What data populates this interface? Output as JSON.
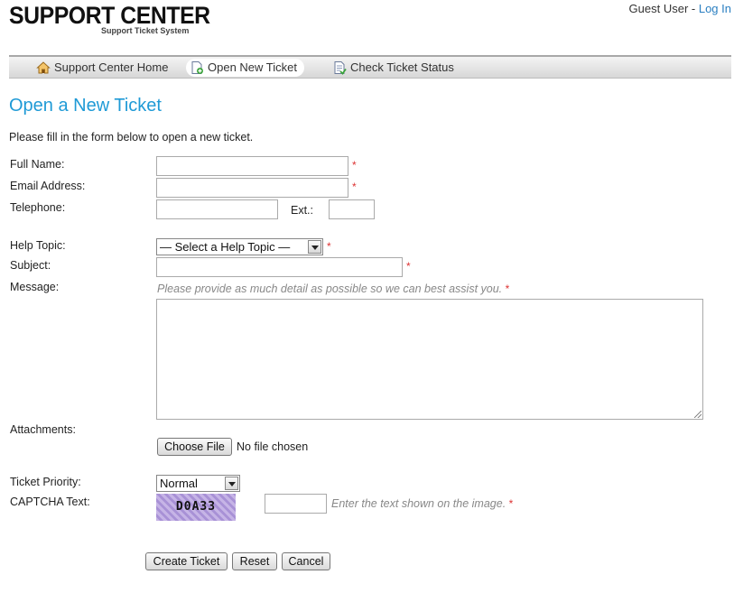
{
  "header": {
    "logo_title": "SUPPORT CENTER",
    "logo_subtitle": "Support Ticket System",
    "user_label": "Guest User",
    "separator": " - ",
    "login_link": "Log In"
  },
  "nav": {
    "items": [
      {
        "label": "Support Center Home",
        "icon": "home-icon"
      },
      {
        "label": "Open New Ticket",
        "icon": "new-ticket-icon",
        "active": true
      },
      {
        "label": "Check Ticket Status",
        "icon": "ticket-status-icon"
      }
    ]
  },
  "page": {
    "title": "Open a New Ticket",
    "intro": "Please fill in the form below to open a new ticket."
  },
  "form": {
    "full_name_label": "Full Name:",
    "email_label": "Email Address:",
    "telephone_label": "Telephone:",
    "ext_label": "Ext.:",
    "help_topic_label": "Help Topic:",
    "help_topic_value": "— Select a Help Topic —",
    "subject_label": "Subject:",
    "message_label": "Message:",
    "message_hint": "Please provide as much detail as possible so we can best assist you.",
    "attachments_label": "Attachments:",
    "choose_file_label": "Choose File",
    "no_file_text": "No file chosen",
    "priority_label": "Ticket Priority:",
    "priority_value": "Normal",
    "captcha_label": "CAPTCHA Text:",
    "captcha_image_text": "D0A33",
    "captcha_hint": "Enter the text shown on the image.",
    "required_mark": "*"
  },
  "buttons": {
    "create": "Create Ticket",
    "reset": "Reset",
    "cancel": "Cancel"
  },
  "colors": {
    "accent": "#1f9ad6",
    "link": "#2a7fc1",
    "required": "#dd3333"
  }
}
